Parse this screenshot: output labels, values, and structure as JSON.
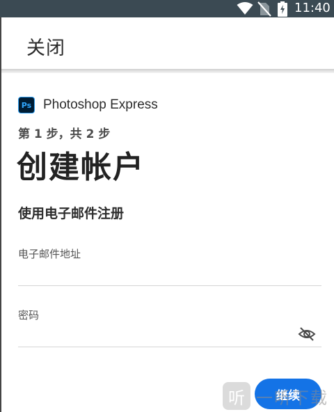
{
  "status_bar": {
    "time": "11:40"
  },
  "app_bar": {
    "close_label": "关闭"
  },
  "brand": {
    "logo_text": "Ps",
    "name": "Photoshop Express"
  },
  "step_indicator": "第 1 步，共 2 步",
  "title": "创建帐户",
  "subtitle": "使用电子邮件注册",
  "email_field": {
    "label": "电子邮件地址",
    "value": ""
  },
  "password_field": {
    "label": "密码",
    "value": "",
    "visibility_icon": "eye-off-icon"
  },
  "continue_button": {
    "label": "继续"
  },
  "watermark": {
    "icon_text": "听",
    "text": "一听下载"
  },
  "colors": {
    "status_bar": "#3b4a53",
    "accent": "#1473e6",
    "logo_bg": "#001d34",
    "logo_fg": "#31a8ff"
  }
}
